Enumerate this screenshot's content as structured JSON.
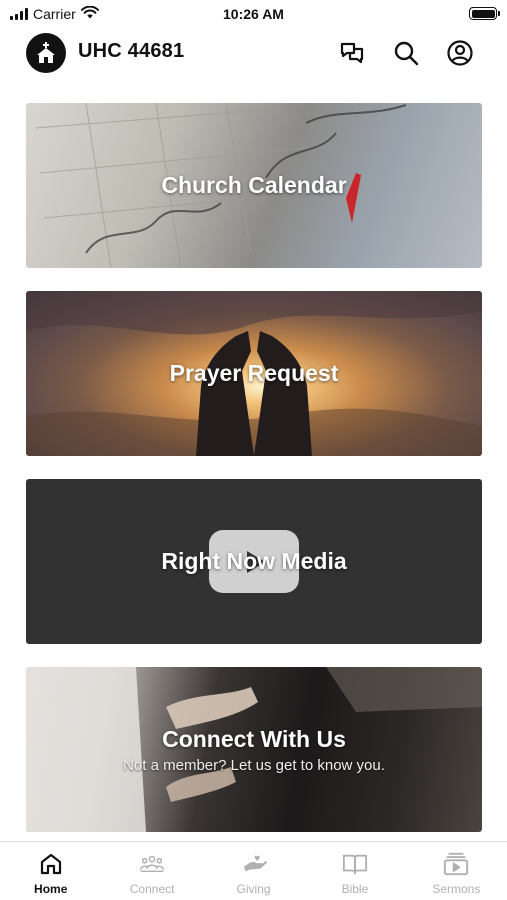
{
  "status_bar": {
    "carrier": "Carrier",
    "time": "10:26 AM"
  },
  "header": {
    "title": "UHC 44681",
    "icons": [
      "church-icon",
      "chat-icon",
      "search-icon",
      "profile-icon"
    ]
  },
  "cards": [
    {
      "title": "Church Calendar",
      "subtitle": ""
    },
    {
      "title": "Prayer Request",
      "subtitle": ""
    },
    {
      "title": "Right Now Media",
      "subtitle": ""
    },
    {
      "title": "Connect With Us",
      "subtitle": "Not a member? Let us get to know you."
    }
  ],
  "tabs": [
    {
      "label": "Home",
      "icon": "home-icon",
      "active": true
    },
    {
      "label": "Connect",
      "icon": "people-icon",
      "active": false
    },
    {
      "label": "Giving",
      "icon": "giving-hand-icon",
      "active": false
    },
    {
      "label": "Bible",
      "icon": "book-icon",
      "active": false
    },
    {
      "label": "Sermons",
      "icon": "video-icon",
      "active": false
    }
  ],
  "colors": {
    "active_tab": "#111111",
    "inactive_tab": "#b0b0b0",
    "media_card": "#323232"
  }
}
